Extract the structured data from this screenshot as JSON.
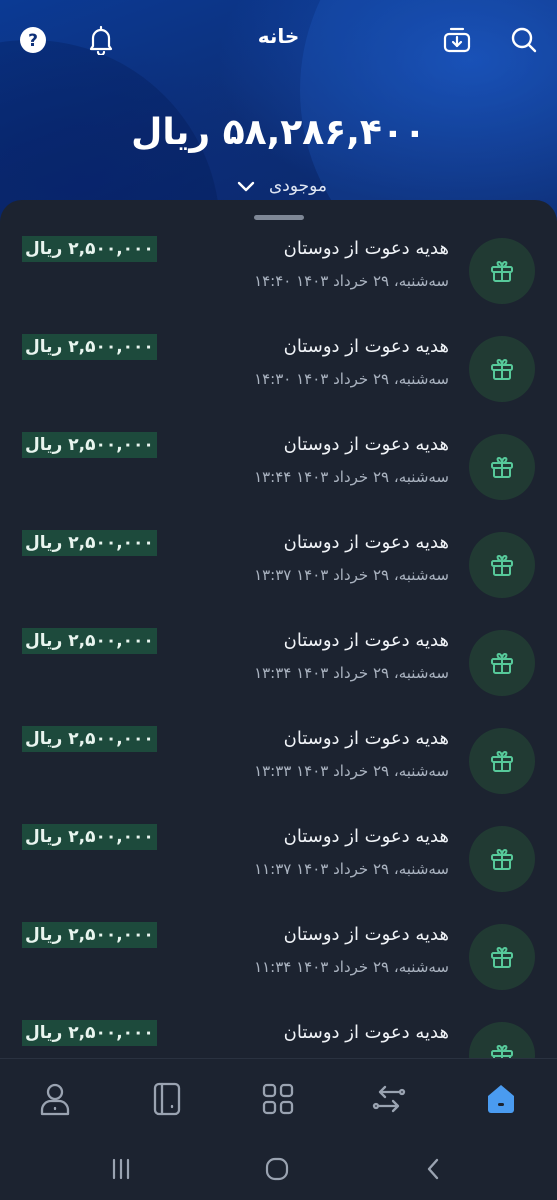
{
  "header": {
    "title": "خانه",
    "icons": [
      "help-icon",
      "bell-icon",
      "download-icon",
      "search-icon"
    ]
  },
  "wallet": {
    "balance": "۵۸,۲۸۶,۴۰۰ ریال",
    "balance_label": "موجودی"
  },
  "transactions": [
    {
      "title": "هدیه دعوت از دوستان",
      "date": "سه‌شنبه، ۲۹ خرداد ۱۴۰۳ ۱۴:۴۰",
      "amount": "۲,۵۰۰,۰۰۰ ریال"
    },
    {
      "title": "هدیه دعوت از دوستان",
      "date": "سه‌شنبه، ۲۹ خرداد ۱۴۰۳ ۱۴:۳۰",
      "amount": "۲,۵۰۰,۰۰۰ ریال"
    },
    {
      "title": "هدیه دعوت از دوستان",
      "date": "سه‌شنبه، ۲۹ خرداد ۱۴۰۳ ۱۳:۴۴",
      "amount": "۲,۵۰۰,۰۰۰ ریال"
    },
    {
      "title": "هدیه دعوت از دوستان",
      "date": "سه‌شنبه، ۲۹ خرداد ۱۴۰۳ ۱۳:۳۷",
      "amount": "۲,۵۰۰,۰۰۰ ریال"
    },
    {
      "title": "هدیه دعوت از دوستان",
      "date": "سه‌شنبه، ۲۹ خرداد ۱۴۰۳ ۱۳:۳۴",
      "amount": "۲,۵۰۰,۰۰۰ ریال"
    },
    {
      "title": "هدیه دعوت از دوستان",
      "date": "سه‌شنبه، ۲۹ خرداد ۱۴۰۳ ۱۳:۳۳",
      "amount": "۲,۵۰۰,۰۰۰ ریال"
    },
    {
      "title": "هدیه دعوت از دوستان",
      "date": "سه‌شنبه، ۲۹ خرداد ۱۴۰۳ ۱۱:۳۷",
      "amount": "۲,۵۰۰,۰۰۰ ریال"
    },
    {
      "title": "هدیه دعوت از دوستان",
      "date": "سه‌شنبه، ۲۹ خرداد ۱۴۰۳ ۱۱:۳۴",
      "amount": "۲,۵۰۰,۰۰۰ ریال"
    },
    {
      "title": "هدیه دعوت از دوستان",
      "date": "",
      "amount": "۲,۵۰۰,۰۰۰ ریال"
    }
  ],
  "bottom_nav": {
    "items": [
      "profile-icon",
      "card-icon",
      "services-icon",
      "transfer-icon",
      "home-icon"
    ],
    "active": "home-icon"
  },
  "colors": {
    "accent": "#4a9bf0",
    "amount_bg": "#1d4a3c",
    "avatar_bg": "#213a33",
    "gift_icon": "#57c99a",
    "sheet_bg": "#1c2330"
  }
}
